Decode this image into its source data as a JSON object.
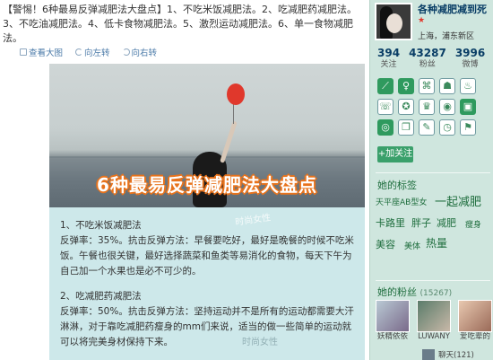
{
  "post": {
    "text": "【警惕！6种最易反弹减肥法大盘点】1、不吃米饭减肥法。2、吃减肥药减肥法。3、不吃油减肥法。4、低卡食物减肥法。5、激烈运动减肥法。6、单一食物减肥法。"
  },
  "toolbar": {
    "view_large": "查看大图",
    "rotate_left": "向左转",
    "rotate_right": "向右转"
  },
  "image": {
    "banner": "6种最易反弹减肥法大盘点",
    "section1_title": "1、不吃米饭减肥法",
    "section1_body": "反弹率：35%。抗击反弹方法：早餐要吃好，最好是晚餐的时候不吃米饭。午餐也很关键，最好选择蔬菜和鱼类等易消化的食物，每天下午为自己加一个水果也是必不可少的。",
    "section2_title": "2、吃减肥药减肥法",
    "section2_body": "反弹率：50%。抗击反弹方法：坚持运动并不是所有的运动都需要大汗淋淋，对于靠吃减肥药瘦身的mm们来说，适当的做一些简单的运动就可以将完美身材保持下来。",
    "watermark": "时尚女性"
  },
  "profile": {
    "name": "各种减肥减到死",
    "badge": "★",
    "location": "上海，浦东新区",
    "stats": [
      {
        "num": "394",
        "label": "关注"
      },
      {
        "num": "43287",
        "label": "粉丝"
      },
      {
        "num": "3996",
        "label": "微博"
      }
    ],
    "follow": "+加关注"
  },
  "icons_row1": [
    "leaf-icon",
    "female-icon",
    "badge-icon",
    "robot-icon",
    "sport-icon"
  ],
  "icons_row2": [
    "talk-icon",
    "medal-icon",
    "crown-icon",
    "coin-icon",
    "box-icon"
  ],
  "icons_row3": [
    "circle-icon",
    "book-icon",
    "tag-icon",
    "clock-icon",
    "flag-icon"
  ],
  "icon_glyphs": {
    "row1": [
      "⟋",
      "♀",
      "⌘",
      "☗",
      "♨"
    ],
    "row2": [
      "☏",
      "✪",
      "♛",
      "◉",
      "▣"
    ],
    "row3": [
      "◎",
      "❐",
      "✎",
      "◷",
      "⚑"
    ]
  },
  "tags_section": {
    "title": "她的标签",
    "tags": [
      "天平座AB型女",
      "一起减肥",
      "卡路里",
      "胖子",
      "减肥",
      "瘦身",
      "美容",
      "美体",
      "热量"
    ]
  },
  "fans_section": {
    "title": "她的粉丝",
    "count": "(15267)",
    "fans": [
      {
        "name": "妖精依依"
      },
      {
        "name": "LUWANY"
      },
      {
        "name": "爱吃辈的"
      }
    ],
    "bottom": [
      "聊天(121)"
    ]
  },
  "colors": {
    "sidebar_bg": "#cfe6de",
    "accent_green": "#3aa06b",
    "card_bg": "#cde8ea",
    "banner_orange": "#e8731c"
  }
}
